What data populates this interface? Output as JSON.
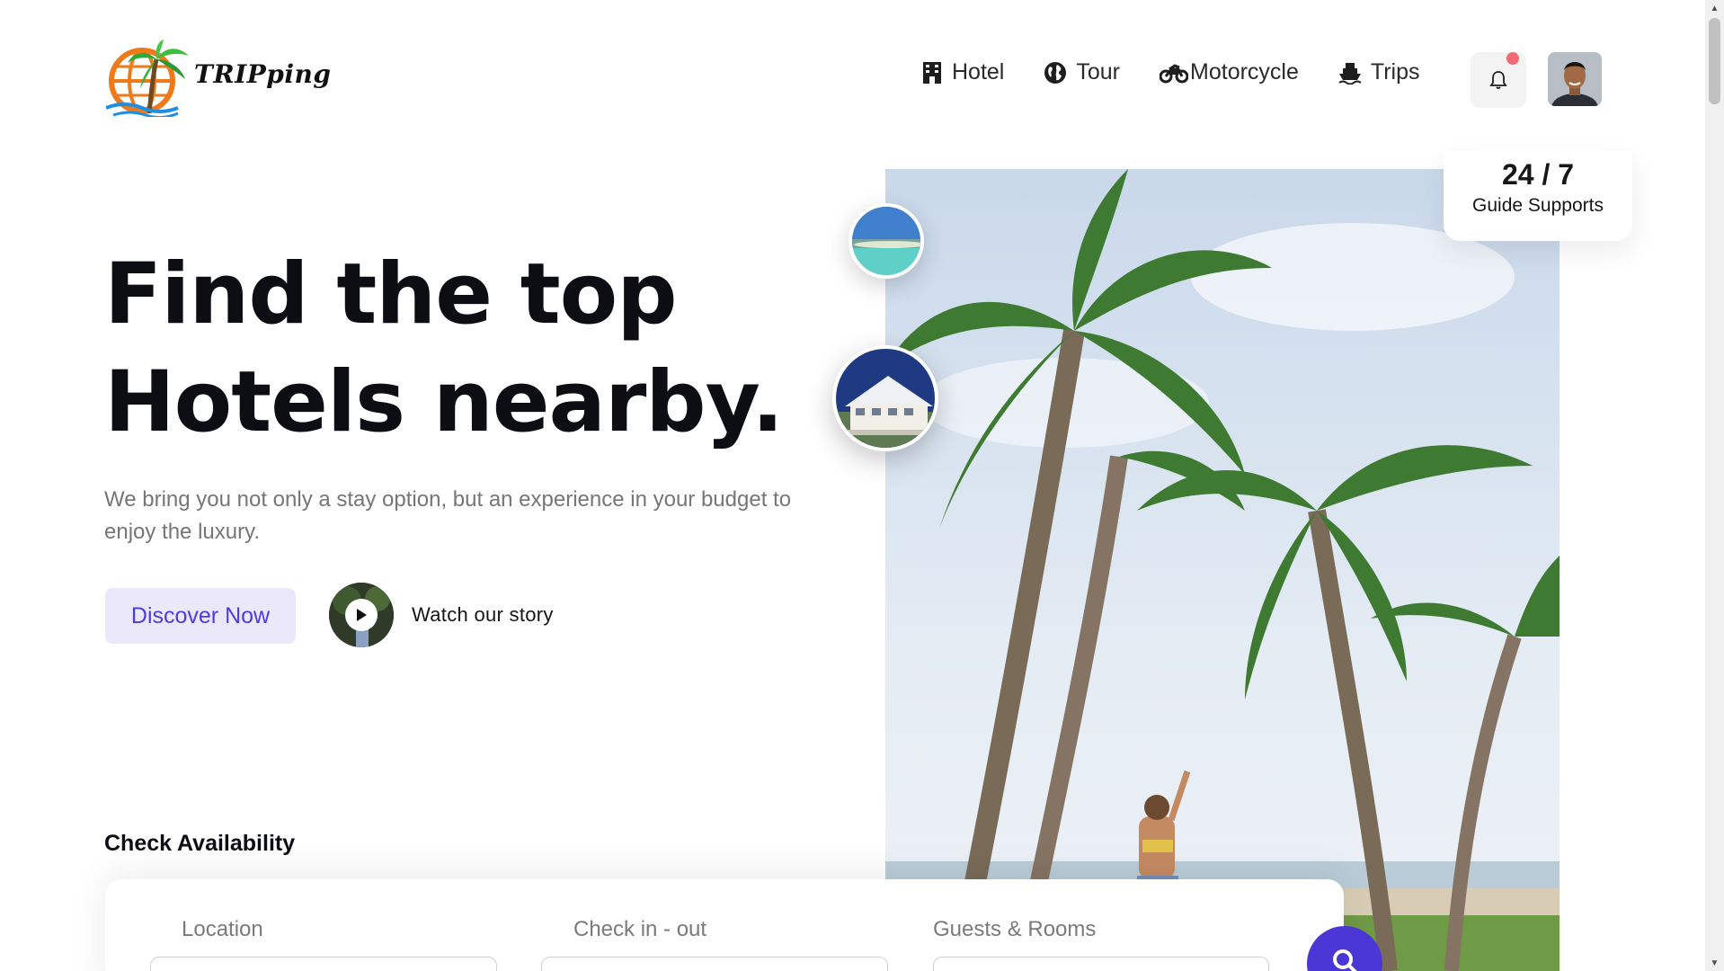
{
  "brand": {
    "logo_text": "TRIPping"
  },
  "nav": {
    "items": [
      {
        "label": "Hotel",
        "icon": "hotel-building-icon"
      },
      {
        "label": "Tour",
        "icon": "globe-icon"
      },
      {
        "label": "Motorcycle",
        "icon": "motorcycle-icon"
      },
      {
        "label": "Trips",
        "icon": "ship-icon"
      }
    ],
    "notification_icon": "bell-icon",
    "notification_dot_color": "#f06b73"
  },
  "hero": {
    "title_line1": "Find the top",
    "title_line2": "Hotels nearby.",
    "subtitle": "We bring you not only a stay option, but an experience in your budget to enjoy the luxury.",
    "discover_label": "Discover Now",
    "watch_label": "Watch our story",
    "accent_color": "#4b3ee0"
  },
  "support": {
    "big": "24 / 7",
    "small": "Guide Supports"
  },
  "availability": {
    "title": "Check Availability",
    "fields": [
      {
        "label": "Location"
      },
      {
        "label": "Check in - out"
      },
      {
        "label": "Guests & Rooms"
      }
    ],
    "search_icon": "search-icon"
  }
}
